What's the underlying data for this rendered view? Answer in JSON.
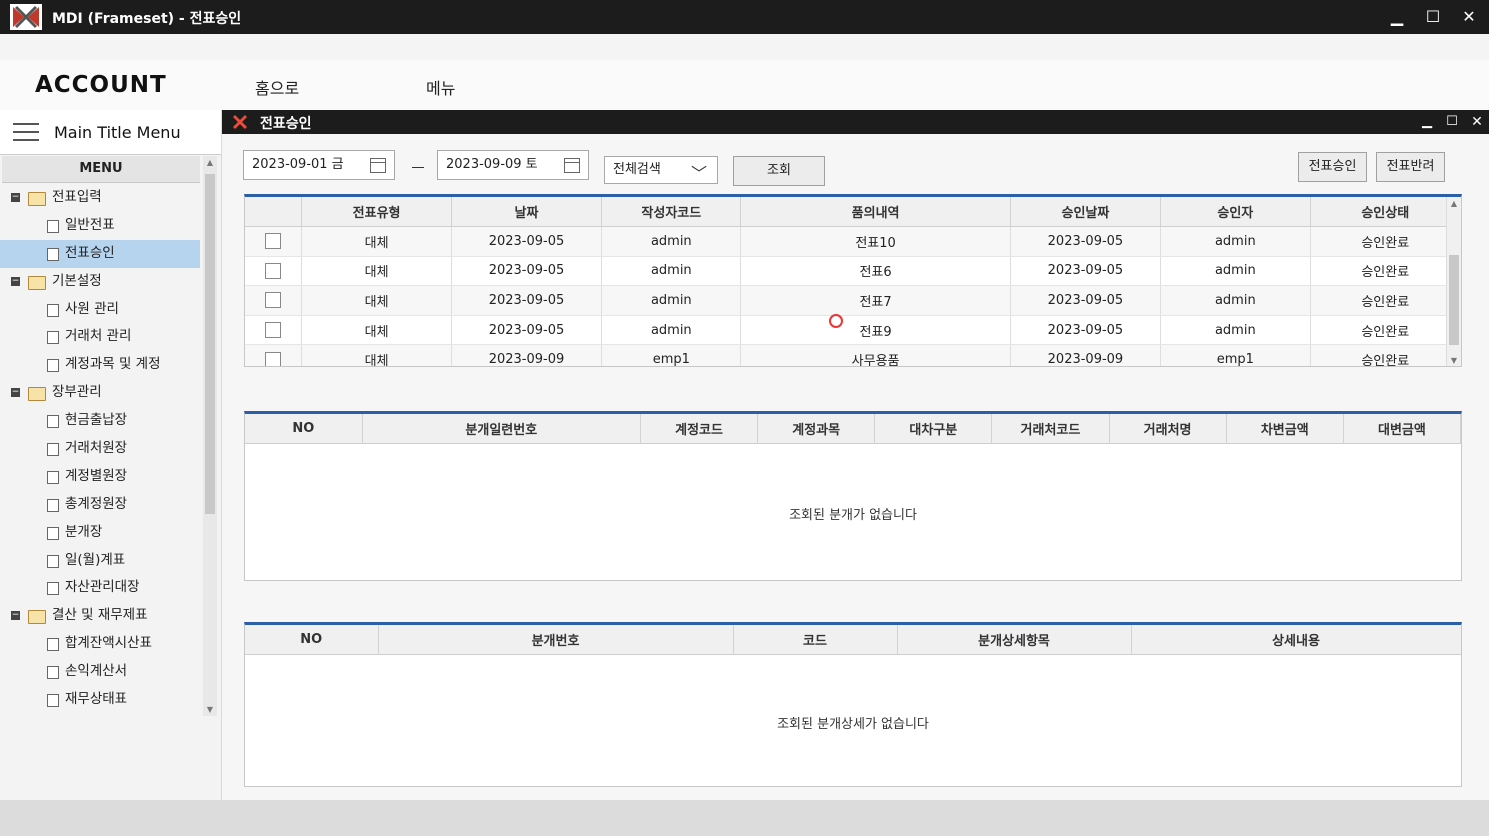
{
  "window": {
    "title": "MDI (Frameset) - 전표승인"
  },
  "header": {
    "brand": "ACCOUNT",
    "nav": [
      "홈으로",
      "메뉴"
    ]
  },
  "sidebar": {
    "title": "Main Title Menu",
    "menu_label": "MENU",
    "tree": [
      {
        "label": "전표입력",
        "type": "group"
      },
      {
        "label": "일반전표",
        "type": "leaf"
      },
      {
        "label": "전표승인",
        "type": "leaf",
        "selected": true
      },
      {
        "label": "기본설정",
        "type": "group"
      },
      {
        "label": "사원 관리",
        "type": "leaf"
      },
      {
        "label": "거래처 관리",
        "type": "leaf"
      },
      {
        "label": "계정과목 및 계정",
        "type": "leaf"
      },
      {
        "label": "장부관리",
        "type": "group"
      },
      {
        "label": "현금출납장",
        "type": "leaf"
      },
      {
        "label": "거래처원장",
        "type": "leaf"
      },
      {
        "label": "계정별원장",
        "type": "leaf"
      },
      {
        "label": "총계정원장",
        "type": "leaf"
      },
      {
        "label": "분개장",
        "type": "leaf"
      },
      {
        "label": "일(월)계표",
        "type": "leaf"
      },
      {
        "label": "자산관리대장",
        "type": "leaf"
      },
      {
        "label": "결산 및 재무제표",
        "type": "group"
      },
      {
        "label": "합계잔액시산표",
        "type": "leaf"
      },
      {
        "label": "손익계산서",
        "type": "leaf"
      },
      {
        "label": "재무상태표",
        "type": "leaf"
      }
    ]
  },
  "panel": {
    "title": "전표승인"
  },
  "filters": {
    "start_date": "2023-09-01 금",
    "end_date": "2023-09-09 토",
    "search_type": "전체검색",
    "search_button": "조회",
    "approve_button": "전표승인",
    "reject_button": "전표반려"
  },
  "voucher_grid": {
    "columns": [
      "",
      "전표유형",
      "날짜",
      "작성자코드",
      "품의내역",
      "승인날짜",
      "승인자",
      "승인상태"
    ],
    "rows": [
      [
        "대체",
        "2023-09-05",
        "admin",
        "전표10",
        "2023-09-05",
        "admin",
        "승인완료"
      ],
      [
        "대체",
        "2023-09-05",
        "admin",
        "전표6",
        "2023-09-05",
        "admin",
        "승인완료"
      ],
      [
        "대체",
        "2023-09-05",
        "admin",
        "전표7",
        "2023-09-05",
        "admin",
        "승인완료"
      ],
      [
        "대체",
        "2023-09-05",
        "admin",
        "전표9",
        "2023-09-05",
        "admin",
        "승인완료"
      ],
      [
        "대체",
        "2023-09-09",
        "emp1",
        "사무용품",
        "2023-09-09",
        "emp1",
        "승인완료"
      ]
    ]
  },
  "journal_grid": {
    "columns": [
      "NO",
      "분개일련번호",
      "계정코드",
      "계정과목",
      "대차구분",
      "거래처코드",
      "거래처명",
      "차변금액",
      "대변금액"
    ],
    "empty_message": "조회된 분개가 없습니다"
  },
  "detail_grid": {
    "columns": [
      "NO",
      "분개번호",
      "코드",
      "분개상세항목",
      "상세내용"
    ],
    "empty_message": "조회된 분개상세가 없습니다"
  }
}
